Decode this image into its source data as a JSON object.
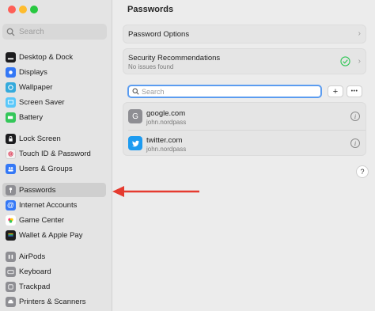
{
  "sidebar": {
    "search_placeholder": "Search",
    "items": [
      {
        "label": "Desktop & Dock",
        "icon": "dock-icon",
        "color": "#1c1c1e"
      },
      {
        "label": "Displays",
        "icon": "display-icon",
        "color": "#3478f6"
      },
      {
        "label": "Wallpaper",
        "icon": "wallpaper-icon",
        "color": "#34aadc"
      },
      {
        "label": "Screen Saver",
        "icon": "screen-saver-icon",
        "color": "#5ac8fa"
      },
      {
        "label": "Battery",
        "icon": "battery-icon",
        "color": "#34c759"
      },
      {
        "label": "Lock Screen",
        "icon": "lock-icon",
        "color": "#1c1c1e"
      },
      {
        "label": "Touch ID & Password",
        "icon": "fingerprint-icon",
        "color": "#f2f2f2"
      },
      {
        "label": "Users & Groups",
        "icon": "users-icon",
        "color": "#3478f6"
      },
      {
        "label": "Passwords",
        "icon": "key-icon",
        "color": "#8e8e93",
        "selected": true
      },
      {
        "label": "Internet Accounts",
        "icon": "at-icon",
        "color": "#3478f6"
      },
      {
        "label": "Game Center",
        "icon": "game-center-icon",
        "color": "#ffffff"
      },
      {
        "label": "Wallet & Apple Pay",
        "icon": "wallet-icon",
        "color": "#1c1c1e"
      },
      {
        "label": "AirPods",
        "icon": "airpods-icon",
        "color": "#8e8e93"
      },
      {
        "label": "Keyboard",
        "icon": "keyboard-icon",
        "color": "#8e8e93"
      },
      {
        "label": "Trackpad",
        "icon": "trackpad-icon",
        "color": "#8e8e93"
      },
      {
        "label": "Printers & Scanners",
        "icon": "printer-icon",
        "color": "#8e8e93"
      }
    ]
  },
  "main": {
    "title": "Passwords",
    "password_options": "Password Options",
    "security": {
      "label": "Security Recommendations",
      "status": "No issues found"
    },
    "search_placeholder": "Search",
    "add_label": "+",
    "more_label": "•••",
    "accounts": [
      {
        "site": "google.com",
        "user": "john.nordpass",
        "icon_letter": "G",
        "icon_color": "#8e8e93"
      },
      {
        "site": "twitter.com",
        "user": "john.nordpass",
        "icon_color": "#1d9bf0"
      }
    ],
    "help_label": "?"
  },
  "colors": {
    "accent": "#3478f6",
    "arrow": "#e53a2f",
    "check": "#34c759"
  }
}
